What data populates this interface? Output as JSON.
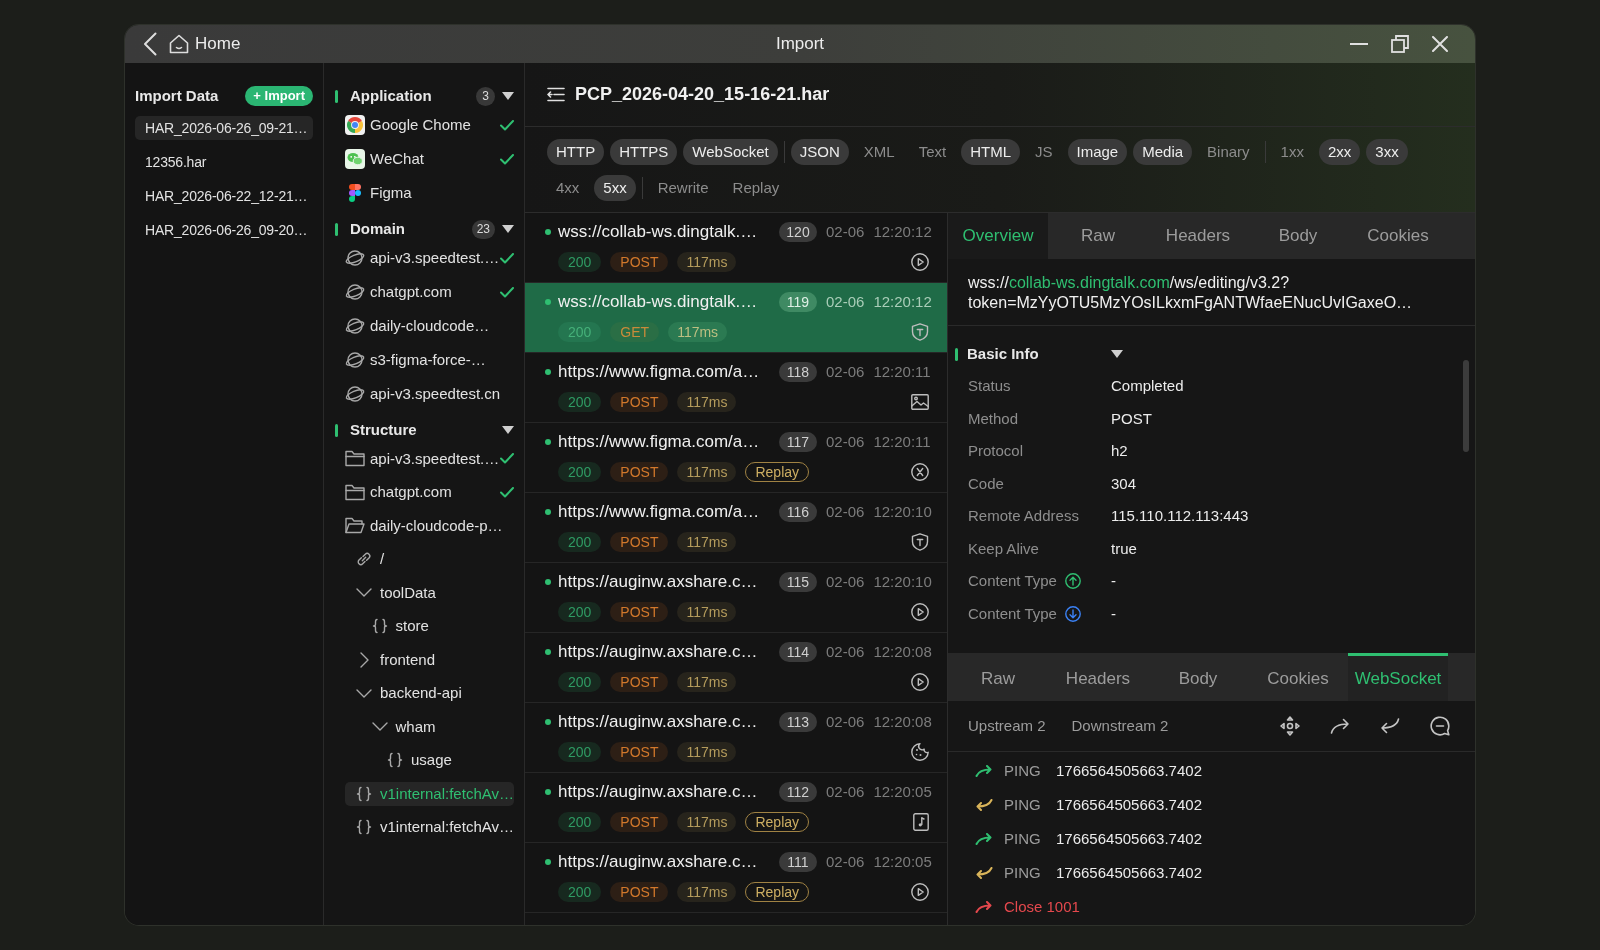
{
  "window": {
    "back_label": "Home",
    "title": "Import"
  },
  "imports": {
    "title": "Import Data",
    "button": "+ Import",
    "files": [
      {
        "name": "HAR_2026-06-26_09-21…",
        "selected": true
      },
      {
        "name": "12356.har",
        "selected": false
      },
      {
        "name": "HAR_2026-06-22_12-21…",
        "selected": false
      },
      {
        "name": "HAR_2026-06-26_09-20…",
        "selected": false
      }
    ]
  },
  "filter_sections": [
    {
      "title": "Application",
      "count": "3",
      "expanded": true,
      "items": [
        {
          "label": "Google Chome",
          "kind": "chrome",
          "checked": true
        },
        {
          "label": "WeChat",
          "kind": "wechat",
          "checked": true
        },
        {
          "label": "Figma",
          "kind": "figma",
          "checked": false
        }
      ]
    },
    {
      "title": "Domain",
      "count": "23",
      "expanded": true,
      "items": [
        {
          "label": "api-v3.speedtest.…",
          "kind": "domain",
          "checked": true
        },
        {
          "label": "chatgpt.com",
          "kind": "domain",
          "checked": true
        },
        {
          "label": "daily-cloudcode…",
          "kind": "domain",
          "checked": false
        },
        {
          "label": "s3-figma-force-…",
          "kind": "domain",
          "checked": false
        },
        {
          "label": "api-v3.speedtest.cn",
          "kind": "domain",
          "checked": false
        }
      ]
    },
    {
      "title": "Structure",
      "expanded": true,
      "items": [
        {
          "label": "api-v3.speedtest.…",
          "kind": "folder",
          "expanded": false,
          "checked": true,
          "selected": false
        },
        {
          "label": "chatgpt.com",
          "kind": "folder",
          "expanded": false,
          "checked": true,
          "selected": false
        },
        {
          "label": "daily-cloudcode-p…",
          "kind": "folder",
          "expanded": true,
          "checked": false,
          "selected": false,
          "children": [
            {
              "label": "/",
              "kind": "link",
              "selected": false
            },
            {
              "label": "toolData",
              "kind": "group",
              "expanded": true,
              "selected": false,
              "children": [
                {
                  "label": "store",
                  "kind": "endpoint",
                  "selected": false
                }
              ]
            },
            {
              "label": "frontend",
              "kind": "group",
              "expanded": false,
              "selected": false
            },
            {
              "label": "backend-api",
              "kind": "group",
              "expanded": true,
              "selected": false,
              "children": [
                {
                  "label": "wham",
                  "kind": "group",
                  "expanded": true,
                  "selected": false,
                  "children": [
                    {
                      "label": "usage",
                      "kind": "endpoint",
                      "selected": false
                    }
                  ]
                }
              ]
            },
            {
              "label": "v1internal:fetchAv…",
              "kind": "endpoint",
              "selected": true
            },
            {
              "label": "v1internal:fetchAv…",
              "kind": "endpoint",
              "selected": false
            }
          ]
        }
      ]
    }
  ],
  "capture": {
    "file": "PCP_2026-04-20_15-16-21.har",
    "filter_groups": [
      [
        {
          "label": "HTTP",
          "selected": true
        },
        {
          "label": "HTTPS",
          "selected": true
        },
        {
          "label": "WebSocket",
          "selected": true
        }
      ],
      [
        {
          "label": "JSON",
          "selected": true
        },
        {
          "label": "XML",
          "selected": false
        },
        {
          "label": "Text",
          "selected": false
        },
        {
          "label": "HTML",
          "selected": true
        },
        {
          "label": "JS",
          "selected": false
        },
        {
          "label": "Image",
          "selected": true
        },
        {
          "label": "Media",
          "selected": true
        },
        {
          "label": "Binary",
          "selected": false
        }
      ],
      [
        {
          "label": "1xx",
          "selected": false
        },
        {
          "label": "2xx",
          "selected": true
        },
        {
          "label": "3xx",
          "selected": true
        },
        {
          "label": "4xx",
          "selected": false
        },
        {
          "label": "5xx",
          "selected": true
        }
      ],
      [
        {
          "label": "Rewrite",
          "selected": false
        },
        {
          "label": "Replay",
          "selected": false
        }
      ]
    ]
  },
  "requests": [
    {
      "url": "wss://collab-ws.dingtalk.…",
      "number": "120",
      "date": "02-06",
      "time": "12:20:12",
      "status": "200",
      "method": "POST",
      "duration": "117ms",
      "kind": "play",
      "selected": false
    },
    {
      "url": "wss://collab-ws.dingtalk.…",
      "number": "119",
      "date": "02-06",
      "time": "12:20:12",
      "status": "200",
      "method": "GET",
      "duration": "117ms",
      "kind": "shield",
      "selected": true
    },
    {
      "url": "https://www.figma.com/a…",
      "number": "118",
      "date": "02-06",
      "time": "12:20:11",
      "status": "200",
      "method": "POST",
      "duration": "117ms",
      "kind": "image",
      "selected": false
    },
    {
      "url": "https://www.figma.com/a…",
      "number": "117",
      "date": "02-06",
      "time": "12:20:11",
      "status": "200",
      "method": "POST",
      "duration": "117ms",
      "tag": "Replay",
      "kind": "blocked",
      "selected": false
    },
    {
      "url": "https://www.figma.com/a…",
      "number": "116",
      "date": "02-06",
      "time": "12:20:10",
      "status": "200",
      "method": "POST",
      "duration": "117ms",
      "kind": "shield",
      "selected": false
    },
    {
      "url": "https://auginw.axshare.c…",
      "number": "115",
      "date": "02-06",
      "time": "12:20:10",
      "status": "200",
      "method": "POST",
      "duration": "117ms",
      "kind": "play",
      "selected": false
    },
    {
      "url": "https://auginw.axshare.c…",
      "number": "114",
      "date": "02-06",
      "time": "12:20:08",
      "status": "200",
      "method": "POST",
      "duration": "117ms",
      "kind": "play",
      "selected": false
    },
    {
      "url": "https://auginw.axshare.c…",
      "number": "113",
      "date": "02-06",
      "time": "12:20:08",
      "status": "200",
      "method": "POST",
      "duration": "117ms",
      "kind": "cookie",
      "selected": false
    },
    {
      "url": "https://auginw.axshare.c…",
      "number": "112",
      "date": "02-06",
      "time": "12:20:05",
      "status": "200",
      "method": "POST",
      "duration": "117ms",
      "tag": "Replay",
      "kind": "audio",
      "selected": false
    },
    {
      "url": "https://auginw.axshare.c…",
      "number": "111",
      "date": "02-06",
      "time": "12:20:05",
      "status": "200",
      "method": "POST",
      "duration": "117ms",
      "tag": "Replay",
      "kind": "play",
      "selected": false
    }
  ],
  "detail": {
    "tabs": [
      {
        "label": "Overview",
        "selected": true
      },
      {
        "label": "Raw",
        "selected": false
      },
      {
        "label": "Headers",
        "selected": false
      },
      {
        "label": "Body",
        "selected": false
      },
      {
        "label": "Cookies",
        "selected": false
      }
    ],
    "url": {
      "scheme": "wss://",
      "host": "collab-ws.dingtalk.com",
      "path": "/ws/editing/v3.2?",
      "query": "token=MzYyOTU5MzYOsILkxmFgANTWfaeENucUvIGaxeO…"
    },
    "basic_info": {
      "title": "Basic Info",
      "expanded": true,
      "rows": [
        {
          "label": "Status",
          "value": "Completed",
          "kind": "plain"
        },
        {
          "label": "Method",
          "value": "POST",
          "kind": "plain"
        },
        {
          "label": "Protocol",
          "value": "h2",
          "kind": "plain"
        },
        {
          "label": "Code",
          "value": "304",
          "kind": "plain"
        },
        {
          "label": "Remote Address",
          "value": "115.110.112.113:443",
          "kind": "plain"
        },
        {
          "label": "Keep Alive",
          "value": "true",
          "kind": "plain"
        },
        {
          "label": "Content Type",
          "value": "-",
          "kind": "upload"
        },
        {
          "label": "Content Type",
          "value": "-",
          "kind": "download"
        }
      ]
    },
    "message_tabs": [
      {
        "label": "Raw",
        "selected": false
      },
      {
        "label": "Headers",
        "selected": false
      },
      {
        "label": "Body",
        "selected": false
      },
      {
        "label": "Cookies",
        "selected": false
      },
      {
        "label": "WebSocket",
        "selected": true
      }
    ],
    "streams": [
      "Upstream 2",
      "Downstream 2"
    ],
    "messages": [
      {
        "kind": "sent",
        "type": "PING",
        "value": "1766564505663.7402"
      },
      {
        "kind": "received",
        "type": "PING",
        "value": "1766564505663.7402"
      },
      {
        "kind": "sent",
        "type": "PING",
        "value": "1766564505663.7402"
      },
      {
        "kind": "received",
        "type": "PING",
        "value": "1766564505663.7402"
      },
      {
        "kind": "close",
        "type": "Close 1001"
      }
    ]
  }
}
